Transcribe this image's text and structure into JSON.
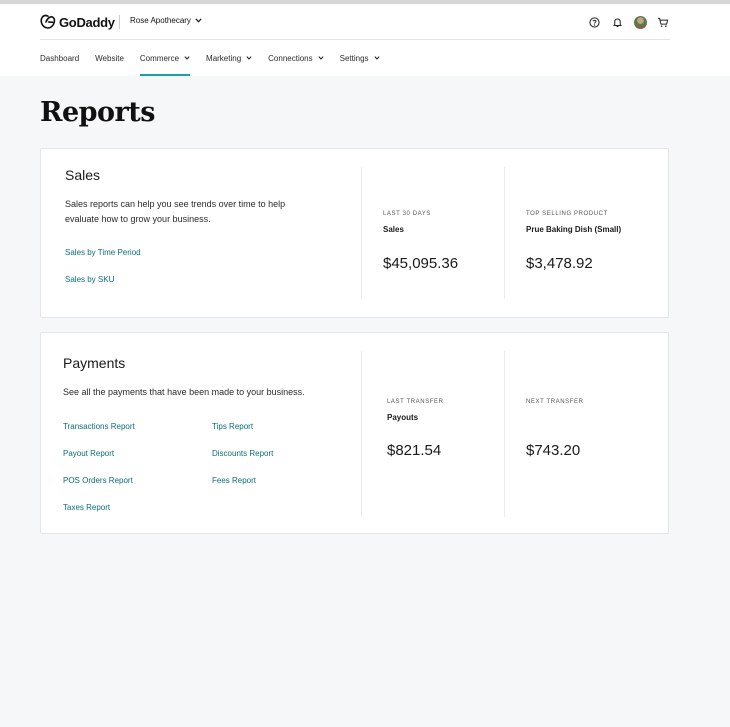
{
  "header": {
    "logo_text": "GoDaddy",
    "store_name": "Rose Apothecary",
    "icons": [
      "help-icon",
      "bell-icon",
      "avatar",
      "cart-icon"
    ]
  },
  "nav": {
    "items": [
      {
        "label": "Dashboard"
      },
      {
        "label": "Website"
      },
      {
        "label": "Commerce"
      },
      {
        "label": "Marketing"
      },
      {
        "label": "Connections"
      },
      {
        "label": "Settings"
      }
    ],
    "active": "Commerce"
  },
  "page": {
    "title": "Reports"
  },
  "sales": {
    "title": "Sales",
    "description_line1": "Sales reports can help you see trends over time to help",
    "description_line2": "evaluate how to grow your business.",
    "links": [
      "Sales by Time Period",
      "Sales by SKU"
    ],
    "stat1": {
      "label": "LAST 30 DAYS",
      "sub": "Sales",
      "value": "$45,095.36"
    },
    "stat2": {
      "label": "TOP SELLING PRODUCT",
      "sub": "Prue Baking Dish (Small)",
      "value": "$3,478.92"
    }
  },
  "payments": {
    "title": "Payments",
    "description": "See all the payments that have been made to your business.",
    "links_col1": [
      "Transactions Report",
      "Payout Report",
      "POS Orders Report",
      "Taxes Report"
    ],
    "links_col2": [
      "Tips Report",
      "Discounts Report",
      "Fees Report"
    ],
    "stat1": {
      "label": "LAST TRANSFER",
      "sub": "Payouts",
      "value": "$821.54"
    },
    "stat2": {
      "label": "NEXT TRANSFER",
      "value": "$743.20"
    }
  },
  "colors": {
    "accent": "#1ba0a8",
    "link": "#0b6e78",
    "background": "#f5f7f8"
  }
}
